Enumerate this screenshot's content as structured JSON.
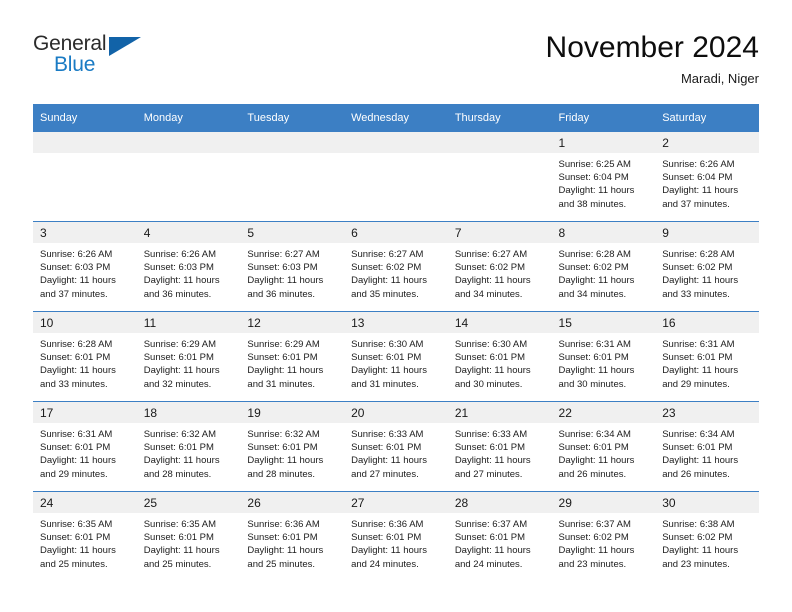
{
  "brand": {
    "general": "General",
    "blue": "Blue",
    "triangle_color": "#1263a8",
    "blue_color": "#1a7bc4"
  },
  "header": {
    "month_title": "November 2024",
    "location": "Maradi, Niger"
  },
  "theme": {
    "header_band": "#3c7fc4",
    "daynum_band": "#f0f0f0",
    "text": "#1c1c1c"
  },
  "weekday_headers": [
    "Sunday",
    "Monday",
    "Tuesday",
    "Wednesday",
    "Thursday",
    "Friday",
    "Saturday"
  ],
  "weeks": [
    [
      {
        "day": "",
        "empty": true,
        "sunrise": "",
        "sunset": "",
        "daylight1": "",
        "daylight2": ""
      },
      {
        "day": "",
        "empty": true,
        "sunrise": "",
        "sunset": "",
        "daylight1": "",
        "daylight2": ""
      },
      {
        "day": "",
        "empty": true,
        "sunrise": "",
        "sunset": "",
        "daylight1": "",
        "daylight2": ""
      },
      {
        "day": "",
        "empty": true,
        "sunrise": "",
        "sunset": "",
        "daylight1": "",
        "daylight2": ""
      },
      {
        "day": "",
        "empty": true,
        "sunrise": "",
        "sunset": "",
        "daylight1": "",
        "daylight2": ""
      },
      {
        "day": "1",
        "empty": false,
        "sunrise": "Sunrise: 6:25 AM",
        "sunset": "Sunset: 6:04 PM",
        "daylight1": "Daylight: 11 hours",
        "daylight2": "and 38 minutes."
      },
      {
        "day": "2",
        "empty": false,
        "sunrise": "Sunrise: 6:26 AM",
        "sunset": "Sunset: 6:04 PM",
        "daylight1": "Daylight: 11 hours",
        "daylight2": "and 37 minutes."
      }
    ],
    [
      {
        "day": "3",
        "empty": false,
        "sunrise": "Sunrise: 6:26 AM",
        "sunset": "Sunset: 6:03 PM",
        "daylight1": "Daylight: 11 hours",
        "daylight2": "and 37 minutes."
      },
      {
        "day": "4",
        "empty": false,
        "sunrise": "Sunrise: 6:26 AM",
        "sunset": "Sunset: 6:03 PM",
        "daylight1": "Daylight: 11 hours",
        "daylight2": "and 36 minutes."
      },
      {
        "day": "5",
        "empty": false,
        "sunrise": "Sunrise: 6:27 AM",
        "sunset": "Sunset: 6:03 PM",
        "daylight1": "Daylight: 11 hours",
        "daylight2": "and 36 minutes."
      },
      {
        "day": "6",
        "empty": false,
        "sunrise": "Sunrise: 6:27 AM",
        "sunset": "Sunset: 6:02 PM",
        "daylight1": "Daylight: 11 hours",
        "daylight2": "and 35 minutes."
      },
      {
        "day": "7",
        "empty": false,
        "sunrise": "Sunrise: 6:27 AM",
        "sunset": "Sunset: 6:02 PM",
        "daylight1": "Daylight: 11 hours",
        "daylight2": "and 34 minutes."
      },
      {
        "day": "8",
        "empty": false,
        "sunrise": "Sunrise: 6:28 AM",
        "sunset": "Sunset: 6:02 PM",
        "daylight1": "Daylight: 11 hours",
        "daylight2": "and 34 minutes."
      },
      {
        "day": "9",
        "empty": false,
        "sunrise": "Sunrise: 6:28 AM",
        "sunset": "Sunset: 6:02 PM",
        "daylight1": "Daylight: 11 hours",
        "daylight2": "and 33 minutes."
      }
    ],
    [
      {
        "day": "10",
        "empty": false,
        "sunrise": "Sunrise: 6:28 AM",
        "sunset": "Sunset: 6:01 PM",
        "daylight1": "Daylight: 11 hours",
        "daylight2": "and 33 minutes."
      },
      {
        "day": "11",
        "empty": false,
        "sunrise": "Sunrise: 6:29 AM",
        "sunset": "Sunset: 6:01 PM",
        "daylight1": "Daylight: 11 hours",
        "daylight2": "and 32 minutes."
      },
      {
        "day": "12",
        "empty": false,
        "sunrise": "Sunrise: 6:29 AM",
        "sunset": "Sunset: 6:01 PM",
        "daylight1": "Daylight: 11 hours",
        "daylight2": "and 31 minutes."
      },
      {
        "day": "13",
        "empty": false,
        "sunrise": "Sunrise: 6:30 AM",
        "sunset": "Sunset: 6:01 PM",
        "daylight1": "Daylight: 11 hours",
        "daylight2": "and 31 minutes."
      },
      {
        "day": "14",
        "empty": false,
        "sunrise": "Sunrise: 6:30 AM",
        "sunset": "Sunset: 6:01 PM",
        "daylight1": "Daylight: 11 hours",
        "daylight2": "and 30 minutes."
      },
      {
        "day": "15",
        "empty": false,
        "sunrise": "Sunrise: 6:31 AM",
        "sunset": "Sunset: 6:01 PM",
        "daylight1": "Daylight: 11 hours",
        "daylight2": "and 30 minutes."
      },
      {
        "day": "16",
        "empty": false,
        "sunrise": "Sunrise: 6:31 AM",
        "sunset": "Sunset: 6:01 PM",
        "daylight1": "Daylight: 11 hours",
        "daylight2": "and 29 minutes."
      }
    ],
    [
      {
        "day": "17",
        "empty": false,
        "sunrise": "Sunrise: 6:31 AM",
        "sunset": "Sunset: 6:01 PM",
        "daylight1": "Daylight: 11 hours",
        "daylight2": "and 29 minutes."
      },
      {
        "day": "18",
        "empty": false,
        "sunrise": "Sunrise: 6:32 AM",
        "sunset": "Sunset: 6:01 PM",
        "daylight1": "Daylight: 11 hours",
        "daylight2": "and 28 minutes."
      },
      {
        "day": "19",
        "empty": false,
        "sunrise": "Sunrise: 6:32 AM",
        "sunset": "Sunset: 6:01 PM",
        "daylight1": "Daylight: 11 hours",
        "daylight2": "and 28 minutes."
      },
      {
        "day": "20",
        "empty": false,
        "sunrise": "Sunrise: 6:33 AM",
        "sunset": "Sunset: 6:01 PM",
        "daylight1": "Daylight: 11 hours",
        "daylight2": "and 27 minutes."
      },
      {
        "day": "21",
        "empty": false,
        "sunrise": "Sunrise: 6:33 AM",
        "sunset": "Sunset: 6:01 PM",
        "daylight1": "Daylight: 11 hours",
        "daylight2": "and 27 minutes."
      },
      {
        "day": "22",
        "empty": false,
        "sunrise": "Sunrise: 6:34 AM",
        "sunset": "Sunset: 6:01 PM",
        "daylight1": "Daylight: 11 hours",
        "daylight2": "and 26 minutes."
      },
      {
        "day": "23",
        "empty": false,
        "sunrise": "Sunrise: 6:34 AM",
        "sunset": "Sunset: 6:01 PM",
        "daylight1": "Daylight: 11 hours",
        "daylight2": "and 26 minutes."
      }
    ],
    [
      {
        "day": "24",
        "empty": false,
        "sunrise": "Sunrise: 6:35 AM",
        "sunset": "Sunset: 6:01 PM",
        "daylight1": "Daylight: 11 hours",
        "daylight2": "and 25 minutes."
      },
      {
        "day": "25",
        "empty": false,
        "sunrise": "Sunrise: 6:35 AM",
        "sunset": "Sunset: 6:01 PM",
        "daylight1": "Daylight: 11 hours",
        "daylight2": "and 25 minutes."
      },
      {
        "day": "26",
        "empty": false,
        "sunrise": "Sunrise: 6:36 AM",
        "sunset": "Sunset: 6:01 PM",
        "daylight1": "Daylight: 11 hours",
        "daylight2": "and 25 minutes."
      },
      {
        "day": "27",
        "empty": false,
        "sunrise": "Sunrise: 6:36 AM",
        "sunset": "Sunset: 6:01 PM",
        "daylight1": "Daylight: 11 hours",
        "daylight2": "and 24 minutes."
      },
      {
        "day": "28",
        "empty": false,
        "sunrise": "Sunrise: 6:37 AM",
        "sunset": "Sunset: 6:01 PM",
        "daylight1": "Daylight: 11 hours",
        "daylight2": "and 24 minutes."
      },
      {
        "day": "29",
        "empty": false,
        "sunrise": "Sunrise: 6:37 AM",
        "sunset": "Sunset: 6:02 PM",
        "daylight1": "Daylight: 11 hours",
        "daylight2": "and 23 minutes."
      },
      {
        "day": "30",
        "empty": false,
        "sunrise": "Sunrise: 6:38 AM",
        "sunset": "Sunset: 6:02 PM",
        "daylight1": "Daylight: 11 hours",
        "daylight2": "and 23 minutes."
      }
    ]
  ]
}
